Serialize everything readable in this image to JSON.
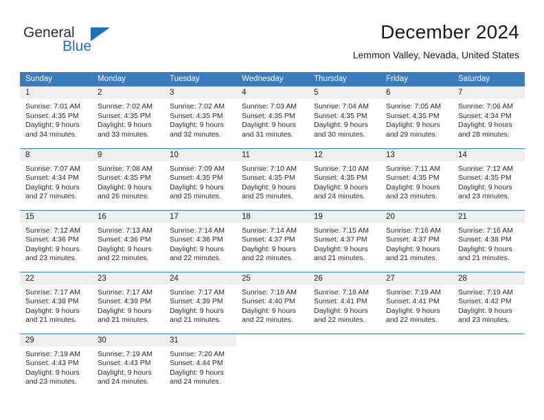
{
  "brand": {
    "name_part1": "General",
    "name_part2": "Blue",
    "triangle_icon": "triangle-icon",
    "accent_color": "#1b72b8"
  },
  "header": {
    "title": "December 2024",
    "subtitle": "Lemmon Valley, Nevada, United States",
    "header_bg_color": "#3a7cc0",
    "daynum_bg_color": "#efefef"
  },
  "weekday_headers": [
    "Sunday",
    "Monday",
    "Tuesday",
    "Wednesday",
    "Thursday",
    "Friday",
    "Saturday"
  ],
  "weeks": [
    [
      {
        "day": "1",
        "sunrise": "Sunrise: 7:01 AM",
        "sunset": "Sunset: 4:35 PM",
        "daylight1": "Daylight: 9 hours",
        "daylight2": "and 34 minutes."
      },
      {
        "day": "2",
        "sunrise": "Sunrise: 7:02 AM",
        "sunset": "Sunset: 4:35 PM",
        "daylight1": "Daylight: 9 hours",
        "daylight2": "and 33 minutes."
      },
      {
        "day": "3",
        "sunrise": "Sunrise: 7:02 AM",
        "sunset": "Sunset: 4:35 PM",
        "daylight1": "Daylight: 9 hours",
        "daylight2": "and 32 minutes."
      },
      {
        "day": "4",
        "sunrise": "Sunrise: 7:03 AM",
        "sunset": "Sunset: 4:35 PM",
        "daylight1": "Daylight: 9 hours",
        "daylight2": "and 31 minutes."
      },
      {
        "day": "5",
        "sunrise": "Sunrise: 7:04 AM",
        "sunset": "Sunset: 4:35 PM",
        "daylight1": "Daylight: 9 hours",
        "daylight2": "and 30 minutes."
      },
      {
        "day": "6",
        "sunrise": "Sunrise: 7:05 AM",
        "sunset": "Sunset: 4:35 PM",
        "daylight1": "Daylight: 9 hours",
        "daylight2": "and 29 minutes."
      },
      {
        "day": "7",
        "sunrise": "Sunrise: 7:06 AM",
        "sunset": "Sunset: 4:34 PM",
        "daylight1": "Daylight: 9 hours",
        "daylight2": "and 28 minutes."
      }
    ],
    [
      {
        "day": "8",
        "sunrise": "Sunrise: 7:07 AM",
        "sunset": "Sunset: 4:34 PM",
        "daylight1": "Daylight: 9 hours",
        "daylight2": "and 27 minutes."
      },
      {
        "day": "9",
        "sunrise": "Sunrise: 7:08 AM",
        "sunset": "Sunset: 4:35 PM",
        "daylight1": "Daylight: 9 hours",
        "daylight2": "and 26 minutes."
      },
      {
        "day": "10",
        "sunrise": "Sunrise: 7:09 AM",
        "sunset": "Sunset: 4:35 PM",
        "daylight1": "Daylight: 9 hours",
        "daylight2": "and 25 minutes."
      },
      {
        "day": "11",
        "sunrise": "Sunrise: 7:10 AM",
        "sunset": "Sunset: 4:35 PM",
        "daylight1": "Daylight: 9 hours",
        "daylight2": "and 25 minutes."
      },
      {
        "day": "12",
        "sunrise": "Sunrise: 7:10 AM",
        "sunset": "Sunset: 4:35 PM",
        "daylight1": "Daylight: 9 hours",
        "daylight2": "and 24 minutes."
      },
      {
        "day": "13",
        "sunrise": "Sunrise: 7:11 AM",
        "sunset": "Sunset: 4:35 PM",
        "daylight1": "Daylight: 9 hours",
        "daylight2": "and 23 minutes."
      },
      {
        "day": "14",
        "sunrise": "Sunrise: 7:12 AM",
        "sunset": "Sunset: 4:35 PM",
        "daylight1": "Daylight: 9 hours",
        "daylight2": "and 23 minutes."
      }
    ],
    [
      {
        "day": "15",
        "sunrise": "Sunrise: 7:12 AM",
        "sunset": "Sunset: 4:36 PM",
        "daylight1": "Daylight: 9 hours",
        "daylight2": "and 23 minutes."
      },
      {
        "day": "16",
        "sunrise": "Sunrise: 7:13 AM",
        "sunset": "Sunset: 4:36 PM",
        "daylight1": "Daylight: 9 hours",
        "daylight2": "and 22 minutes."
      },
      {
        "day": "17",
        "sunrise": "Sunrise: 7:14 AM",
        "sunset": "Sunset: 4:36 PM",
        "daylight1": "Daylight: 9 hours",
        "daylight2": "and 22 minutes."
      },
      {
        "day": "18",
        "sunrise": "Sunrise: 7:14 AM",
        "sunset": "Sunset: 4:37 PM",
        "daylight1": "Daylight: 9 hours",
        "daylight2": "and 22 minutes."
      },
      {
        "day": "19",
        "sunrise": "Sunrise: 7:15 AM",
        "sunset": "Sunset: 4:37 PM",
        "daylight1": "Daylight: 9 hours",
        "daylight2": "and 21 minutes."
      },
      {
        "day": "20",
        "sunrise": "Sunrise: 7:16 AM",
        "sunset": "Sunset: 4:37 PM",
        "daylight1": "Daylight: 9 hours",
        "daylight2": "and 21 minutes."
      },
      {
        "day": "21",
        "sunrise": "Sunrise: 7:16 AM",
        "sunset": "Sunset: 4:38 PM",
        "daylight1": "Daylight: 9 hours",
        "daylight2": "and 21 minutes."
      }
    ],
    [
      {
        "day": "22",
        "sunrise": "Sunrise: 7:17 AM",
        "sunset": "Sunset: 4:38 PM",
        "daylight1": "Daylight: 9 hours",
        "daylight2": "and 21 minutes."
      },
      {
        "day": "23",
        "sunrise": "Sunrise: 7:17 AM",
        "sunset": "Sunset: 4:39 PM",
        "daylight1": "Daylight: 9 hours",
        "daylight2": "and 21 minutes."
      },
      {
        "day": "24",
        "sunrise": "Sunrise: 7:17 AM",
        "sunset": "Sunset: 4:39 PM",
        "daylight1": "Daylight: 9 hours",
        "daylight2": "and 21 minutes."
      },
      {
        "day": "25",
        "sunrise": "Sunrise: 7:18 AM",
        "sunset": "Sunset: 4:40 PM",
        "daylight1": "Daylight: 9 hours",
        "daylight2": "and 22 minutes."
      },
      {
        "day": "26",
        "sunrise": "Sunrise: 7:18 AM",
        "sunset": "Sunset: 4:41 PM",
        "daylight1": "Daylight: 9 hours",
        "daylight2": "and 22 minutes."
      },
      {
        "day": "27",
        "sunrise": "Sunrise: 7:19 AM",
        "sunset": "Sunset: 4:41 PM",
        "daylight1": "Daylight: 9 hours",
        "daylight2": "and 22 minutes."
      },
      {
        "day": "28",
        "sunrise": "Sunrise: 7:19 AM",
        "sunset": "Sunset: 4:42 PM",
        "daylight1": "Daylight: 9 hours",
        "daylight2": "and 23 minutes."
      }
    ],
    [
      {
        "day": "29",
        "sunrise": "Sunrise: 7:19 AM",
        "sunset": "Sunset: 4:43 PM",
        "daylight1": "Daylight: 9 hours",
        "daylight2": "and 23 minutes."
      },
      {
        "day": "30",
        "sunrise": "Sunrise: 7:19 AM",
        "sunset": "Sunset: 4:43 PM",
        "daylight1": "Daylight: 9 hours",
        "daylight2": "and 24 minutes."
      },
      {
        "day": "31",
        "sunrise": "Sunrise: 7:20 AM",
        "sunset": "Sunset: 4:44 PM",
        "daylight1": "Daylight: 9 hours",
        "daylight2": "and 24 minutes."
      },
      {
        "day": "",
        "sunrise": "",
        "sunset": "",
        "daylight1": "",
        "daylight2": ""
      },
      {
        "day": "",
        "sunrise": "",
        "sunset": "",
        "daylight1": "",
        "daylight2": ""
      },
      {
        "day": "",
        "sunrise": "",
        "sunset": "",
        "daylight1": "",
        "daylight2": ""
      },
      {
        "day": "",
        "sunrise": "",
        "sunset": "",
        "daylight1": "",
        "daylight2": ""
      }
    ]
  ]
}
